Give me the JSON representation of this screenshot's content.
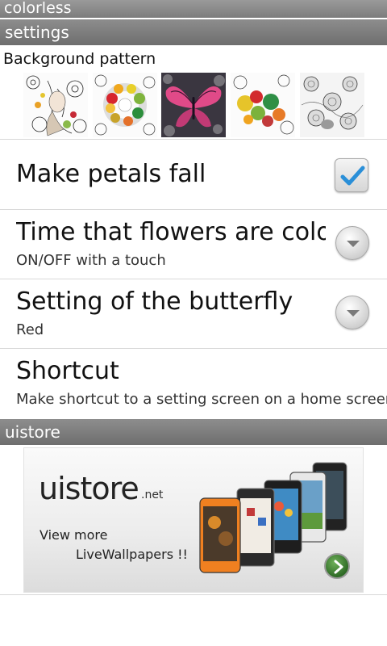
{
  "app": {
    "title": "colorless"
  },
  "settings_section": {
    "header": "settings",
    "background_pattern_label": "Background pattern",
    "patterns": [
      "woman-with-flowers",
      "colored-flower-ring",
      "pink-butterfly",
      "colored-flowers",
      "grayscale-flowers"
    ]
  },
  "preferences": [
    {
      "title": "Make petals fall",
      "summary": "",
      "control": "checkbox",
      "checked": true
    },
    {
      "title": "Time that flowers are colored",
      "summary": "ON/OFF with a touch",
      "control": "dropdown"
    },
    {
      "title": "Setting of the butterfly",
      "summary": "Red",
      "control": "dropdown"
    },
    {
      "title": "Shortcut",
      "summary": "Make shortcut to a setting screen on a home screen",
      "control": "none"
    }
  ],
  "uistore_section": {
    "header": "uistore",
    "banner": {
      "brand": "uistore",
      "brand_suffix": ".net",
      "line1": "View more",
      "line2": "LiveWallpapers !!"
    }
  },
  "colors": {
    "header_bg": "#7a7a7a",
    "checkbox_check": "#2a8fd8",
    "go_button": "#3f8a31"
  }
}
